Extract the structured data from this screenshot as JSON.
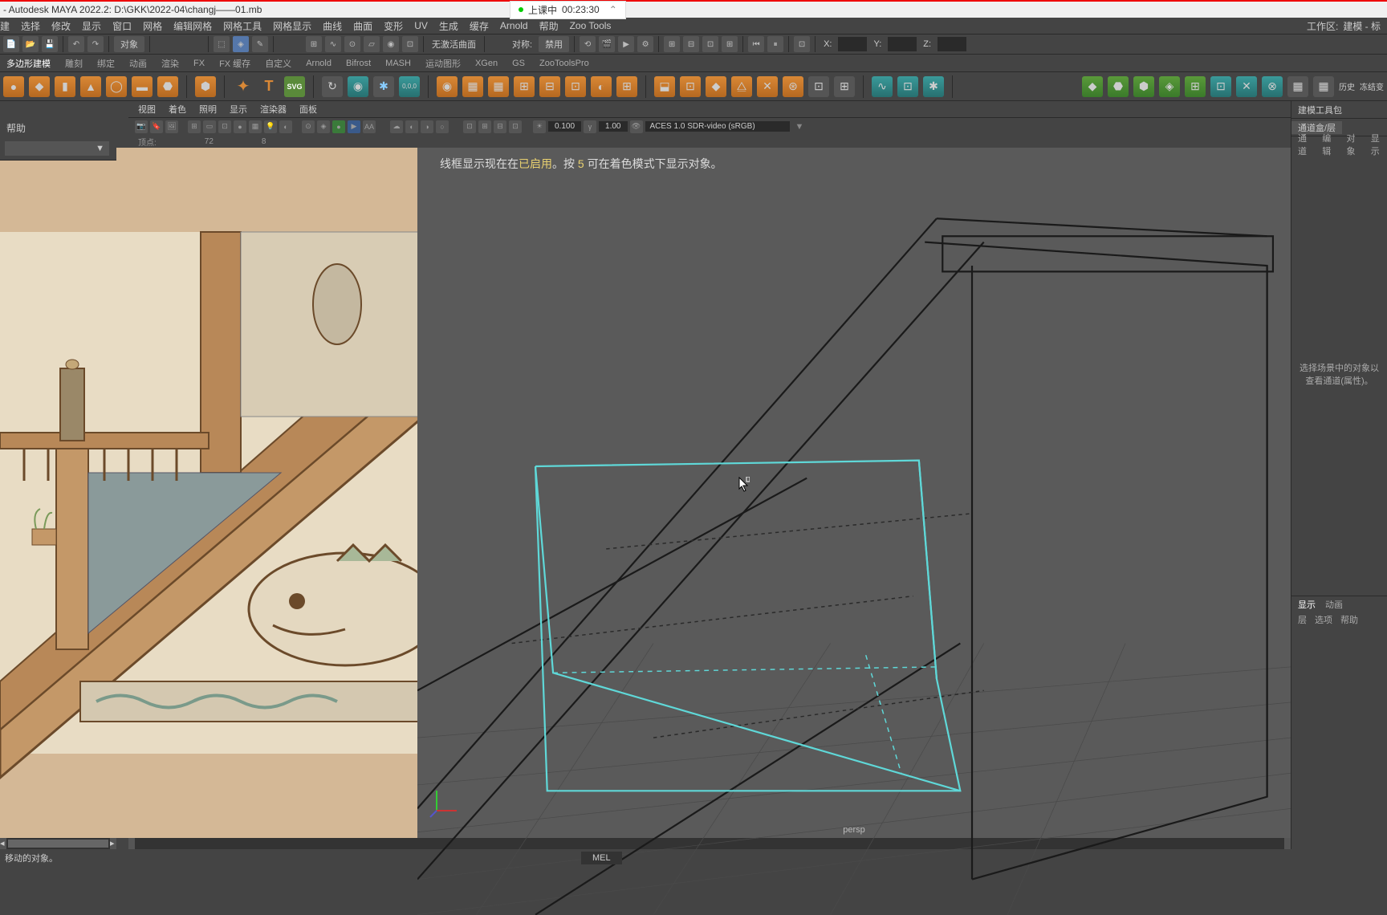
{
  "title_bar": {
    "text": "- Autodesk MAYA 2022.2: D:\\GKK\\2022-04\\changj——01.mb",
    "class_status": "上课中",
    "class_time": "00:23:30"
  },
  "menu": {
    "items": [
      "建",
      "选择",
      "修改",
      "显示",
      "窗口",
      "网格",
      "编辑网格",
      "网格工具",
      "网格显示",
      "曲线",
      "曲面",
      "变形",
      "UV",
      "生成",
      "缓存",
      "Arnold",
      "帮助",
      "Zoo Tools"
    ],
    "workspace_label": "工作区:",
    "workspace_value": "建模 - 标"
  },
  "toolbar1": {
    "mode": "对象",
    "nosym": "无激活曲面",
    "sym_label": "对称:",
    "sym_value": "禁用",
    "x": "X:",
    "y": "Y:",
    "z": "Z:"
  },
  "shelf_tabs": [
    "多边形建模",
    "雕刻",
    "绑定",
    "动画",
    "渲染",
    "FX",
    "FX 缓存",
    "自定义",
    "Arnold",
    "Bifrost",
    "MASH",
    "运动图形",
    "XGen",
    "GS",
    "ZooToolsPro"
  ],
  "shelf_side": {
    "history": "历史",
    "freeze": "冻结变"
  },
  "left_help": "帮助",
  "viewport": {
    "menu": [
      "视图",
      "着色",
      "照明",
      "显示",
      "渲染器",
      "面板"
    ],
    "counter_label": "顶点:",
    "counter_values": [
      "72",
      "8"
    ],
    "gamma1": "0.100",
    "gamma2": "1.00",
    "colorspace": "ACES 1.0 SDR-video (sRGB)",
    "hint_pre": "线框显示现在在",
    "hint_on": "已启用",
    "hint_mid": "。按 ",
    "hint_key": "5",
    "hint_post": " 可在着色模式下显示对象。",
    "persp": "persp"
  },
  "right_panel": {
    "top_tabs": [
      "建模工具包",
      "通道盒/层"
    ],
    "sub_tabs": [
      "通道",
      "编辑",
      "对象",
      "显示"
    ],
    "empty_msg": "选择场景中的对象以查看通道(属性)。",
    "lower_tabs": [
      "显示",
      "动画"
    ],
    "lower_sub": [
      "层",
      "选项",
      "帮助"
    ]
  },
  "status_bar": {
    "text": "移动的对象。",
    "mel": "MEL"
  }
}
